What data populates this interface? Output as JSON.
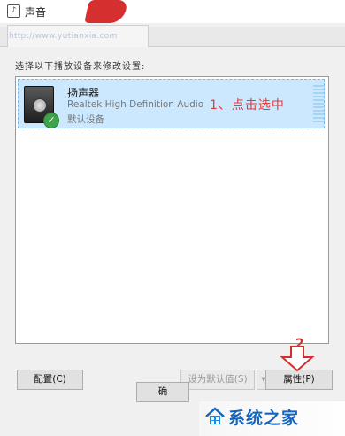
{
  "window": {
    "title": "声音"
  },
  "tab": {
    "watermark": "http://www.yutianxia.com"
  },
  "instruction": "选择以下播放设备来修改设置:",
  "device": {
    "name": "扬声器",
    "driver": "Realtek High Definition Audio",
    "status": "默认设备"
  },
  "annotations": {
    "step1": "1、点击选中",
    "step2": "2"
  },
  "buttons": {
    "configure": "配置(C)",
    "set_default": "设为默认值(S)",
    "set_default_arrow": "▾",
    "properties": "属性(P)",
    "ok": "确"
  },
  "watermark": {
    "text": "系统之家"
  },
  "icons": {
    "title": "sound-icon",
    "device": "speaker-icon",
    "status": "check-icon",
    "annotation": "arrow-down-icon",
    "brand": "house-logo-icon"
  },
  "colors": {
    "selection": "#cce8ff",
    "annotation": "#e53935",
    "brand": "#1565c0",
    "check": "#3fa34a"
  }
}
